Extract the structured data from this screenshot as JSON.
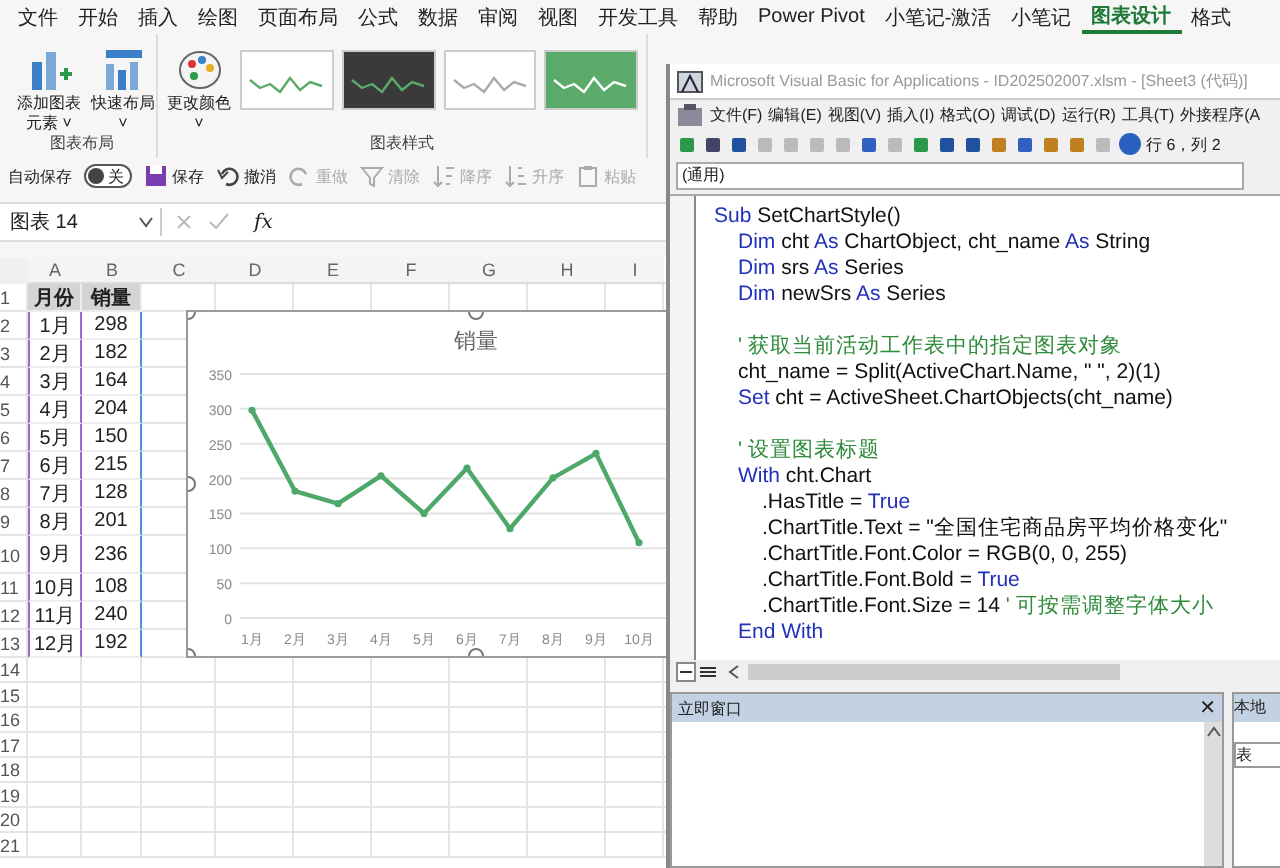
{
  "menu_tabs": [
    {
      "label": "文件",
      "selected": false
    },
    {
      "label": "开始",
      "selected": false
    },
    {
      "label": "插入",
      "selected": false
    },
    {
      "label": "绘图",
      "selected": false
    },
    {
      "label": "页面布局",
      "selected": false
    },
    {
      "label": "公式",
      "selected": false
    },
    {
      "label": "数据",
      "selected": false
    },
    {
      "label": "审阅",
      "selected": false
    },
    {
      "label": "视图",
      "selected": false
    },
    {
      "label": "开发工具",
      "selected": false
    },
    {
      "label": "帮助",
      "selected": false
    },
    {
      "label": "Power Pivot",
      "selected": false
    },
    {
      "label": "小笔记-激活",
      "selected": false
    },
    {
      "label": "小笔记",
      "selected": false
    },
    {
      "label": "图表设计",
      "selected": true
    },
    {
      "label": "格式",
      "selected": false
    }
  ],
  "ribbon": {
    "groups": [
      {
        "label": "图表布局",
        "buttons": [
          {
            "kind": "add-element",
            "label": "添加图表元素 ˅"
          },
          {
            "kind": "layout",
            "label": "快速布局 ˅"
          }
        ]
      },
      {
        "label": "图表样式",
        "buttons": [
          {
            "kind": "palette",
            "label": "更改颜色 ˅"
          }
        ],
        "styles": [
          {
            "color": "#ffffff"
          },
          {
            "color": "#3a3a3a"
          },
          {
            "color": "#ffffff"
          },
          {
            "color": "#5aaa6a"
          }
        ]
      }
    ]
  },
  "quick_access": [
    {
      "kind": "label",
      "label": "自动保存"
    },
    {
      "kind": "toggle",
      "label": "关",
      "on": false
    },
    {
      "kind": "save",
      "label": "保存",
      "disabled": false
    },
    {
      "kind": "undo",
      "label": "撤消",
      "disabled": false
    },
    {
      "kind": "redo",
      "label": "重做",
      "disabled": true
    },
    {
      "kind": "clear",
      "label": "清除",
      "disabled": true
    },
    {
      "kind": "sort-desc",
      "label": "降序",
      "disabled": true
    },
    {
      "kind": "sort-asc",
      "label": "升序",
      "disabled": true
    },
    {
      "kind": "paste",
      "label": "粘贴",
      "disabled": true
    }
  ],
  "formula_bar": {
    "name_box": "图表 14",
    "fx": "fx"
  },
  "sheet": {
    "columns": [
      "A",
      "B",
      "C",
      "D",
      "E",
      "F",
      "G",
      "H",
      "I"
    ],
    "row_numbers": [
      "1",
      "2",
      "3",
      "4",
      "5",
      "6",
      "7",
      "8",
      "9",
      "10",
      "11",
      "12",
      "13",
      "14",
      "15",
      "16",
      "17",
      "18",
      "19",
      "20",
      "21"
    ],
    "header": [
      "月份",
      "销量"
    ],
    "rows": [
      [
        "1月",
        "298"
      ],
      [
        "2月",
        "182"
      ],
      [
        "3月",
        "164"
      ],
      [
        "4月",
        "204"
      ],
      [
        "5月",
        "150"
      ],
      [
        "6月",
        "215"
      ],
      [
        "7月",
        "128"
      ],
      [
        "8月",
        "201"
      ],
      [
        "9月",
        "236"
      ],
      [
        "10月",
        "108"
      ],
      [
        "11月",
        "240"
      ],
      [
        "12月",
        "192"
      ]
    ],
    "chart": {
      "title": "销量",
      "chart_data": {
        "type": "line",
        "categories": [
          "1月",
          "2月",
          "3月",
          "4月",
          "5月",
          "6月",
          "7月",
          "8月",
          "9月",
          "10月"
        ],
        "series": [
          {
            "color": "#4ea86a",
            "marker": true,
            "values": [
              298,
              182,
              164,
              204,
              150,
              215,
              128,
              201,
              236,
              108
            ]
          }
        ],
        "grid": true,
        "ylim": [
          0,
          350
        ],
        "yticks": [
          0,
          50,
          100,
          150,
          200,
          250,
          300,
          350
        ]
      }
    }
  },
  "vba": {
    "title": "Microsoft Visual Basic for Applications - ID202502007.xlsm - [Sheet3 (代码)]",
    "menus": [
      "文件(F)",
      "编辑(E)",
      "视图(V)",
      "插入(I)",
      "格式(O)",
      "调试(D)",
      "运行(R)",
      "工具(T)",
      "外接程序(A"
    ],
    "position": "行 6，列 2",
    "object_box": "(通用)",
    "code": [
      {
        "segments": [
          {
            "kind": "keyword",
            "text": "Sub"
          },
          {
            "kind": "text",
            "text": " SetChartStyle()"
          }
        ],
        "children": [
          {
            "segments": [
              {
                "kind": "keyword",
                "text": "Dim"
              },
              {
                "kind": "text",
                "text": " cht "
              },
              {
                "kind": "keyword",
                "text": "As"
              },
              {
                "kind": "text",
                "text": " ChartObject, cht_name "
              },
              {
                "kind": "keyword",
                "text": "As"
              },
              {
                "kind": "text",
                "text": " String"
              }
            ]
          },
          {
            "segments": [
              {
                "kind": "keyword",
                "text": "Dim"
              },
              {
                "kind": "text",
                "text": " srs "
              },
              {
                "kind": "keyword",
                "text": "As"
              },
              {
                "kind": "text",
                "text": " Series"
              }
            ]
          },
          {
            "segments": [
              {
                "kind": "keyword",
                "text": "Dim"
              },
              {
                "kind": "text",
                "text": " newSrs "
              },
              {
                "kind": "keyword",
                "text": "As"
              },
              {
                "kind": "text",
                "text": " Series"
              }
            ]
          },
          {
            "kind": "blank"
          },
          {
            "segments": [
              {
                "kind": "comment",
                "text": "' 获取当前活动工作表中的指定图表对象"
              }
            ]
          },
          {
            "segments": [
              {
                "kind": "text",
                "text": "cht_name = Split(ActiveChart.Name, \" \", 2)(1)"
              }
            ]
          },
          {
            "segments": [
              {
                "kind": "keyword",
                "text": "Set"
              },
              {
                "kind": "text",
                "text": " cht = ActiveSheet.ChartObjects(cht_name)"
              }
            ]
          },
          {
            "kind": "blank"
          },
          {
            "segments": [
              {
                "kind": "comment",
                "text": "' 设置图表标题"
              }
            ]
          },
          {
            "segments": [
              {
                "kind": "keyword",
                "text": "With"
              },
              {
                "kind": "text",
                "text": " cht.Chart"
              }
            ],
            "children": [
              {
                "segments": [
                  {
                    "kind": "text",
                    "text": ".HasTitle = "
                  },
                  {
                    "kind": "keyword",
                    "text": "True"
                  }
                ]
              },
              {
                "segments": [
                  {
                    "kind": "text",
                    "text": ".ChartTitle.Text = \"全国住宅商品房平均价格变化\""
                  }
                ]
              },
              {
                "segments": [
                  {
                    "kind": "text",
                    "text": ".ChartTitle.Font.Color = RGB(0, 0, 255)"
                  }
                ]
              },
              {
                "segments": [
                  {
                    "kind": "text",
                    "text": ".ChartTitle.Font.Bold = "
                  },
                  {
                    "kind": "keyword",
                    "text": "True"
                  }
                ]
              },
              {
                "segments": [
                  {
                    "kind": "text",
                    "text": ".ChartTitle.Font.Size = 14 "
                  },
                  {
                    "kind": "comment",
                    "text": "' 可按需调整字体大小"
                  }
                ]
              }
            ]
          },
          {
            "segments": [
              {
                "kind": "keyword",
                "text": "End With"
              }
            ]
          }
        ]
      }
    ],
    "immediate": {
      "title": "立即窗口",
      "close": "✕"
    },
    "locals": {
      "title": "本地",
      "column": "表"
    }
  }
}
